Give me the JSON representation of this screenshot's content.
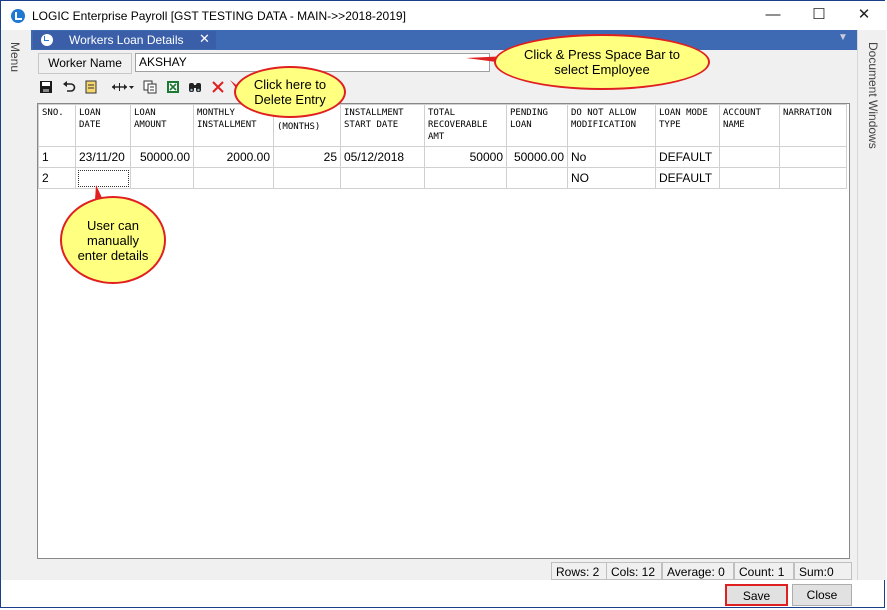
{
  "window": {
    "title": "LOGIC Enterprise Payroll  [GST TESTING DATA - MAIN->>2018-2019]",
    "minimize": "—",
    "maximize": "☐",
    "close": "✕"
  },
  "side": {
    "left_label": "Menu",
    "right_label": "Document Windows"
  },
  "tab": {
    "label": "Workers Loan Details",
    "close": "✕"
  },
  "form": {
    "worker_name_label": "Worker Name",
    "worker_name_value": "AKSHAY"
  },
  "toolbar": {
    "icons": [
      "save-icon",
      "undo-icon",
      "notes-icon",
      "resize-columns-icon",
      "copy-icon",
      "excel-icon",
      "find-icon",
      "delete-icon"
    ]
  },
  "grid": {
    "columns": [
      "SNO.",
      "LOAN DATE",
      "LOAN AMOUNT",
      "MONTHLY INSTALLMENT",
      "(MONTHS)",
      "INSTALLMENT START DATE",
      "TOTAL RECOVERABLE AMT",
      "PENDING LOAN",
      "DO NOT ALLOW MODIFICATION",
      "LOAN MODE TYPE",
      "ACCOUNT NAME",
      "NARRATION"
    ],
    "rows": [
      [
        "1",
        "23/11/20",
        "50000.00",
        "2000.00",
        "25",
        "05/12/2018",
        "50000",
        "50000.00",
        "No",
        "DEFAULT",
        "",
        ""
      ],
      [
        "2",
        "",
        "",
        "",
        "",
        "",
        "",
        "",
        "NO",
        "DEFAULT",
        "",
        ""
      ]
    ]
  },
  "status": {
    "rows": "Rows: 2",
    "cols": "Cols: 12",
    "average": "Average: 0",
    "count": "Count: 1",
    "sum": "Sum:0"
  },
  "buttons": {
    "save": "Save",
    "close": "Close"
  },
  "callouts": {
    "select_employee": "Click & Press Space Bar to select Employee",
    "delete_entry": "Click here to Delete Entry",
    "manual_entry": "User can manually enter details"
  },
  "colors": {
    "tab_bar": "#3e6ab4",
    "callout_fill": "#ffff80",
    "callout_border": "#e02020",
    "save_highlight": "#e02020"
  }
}
